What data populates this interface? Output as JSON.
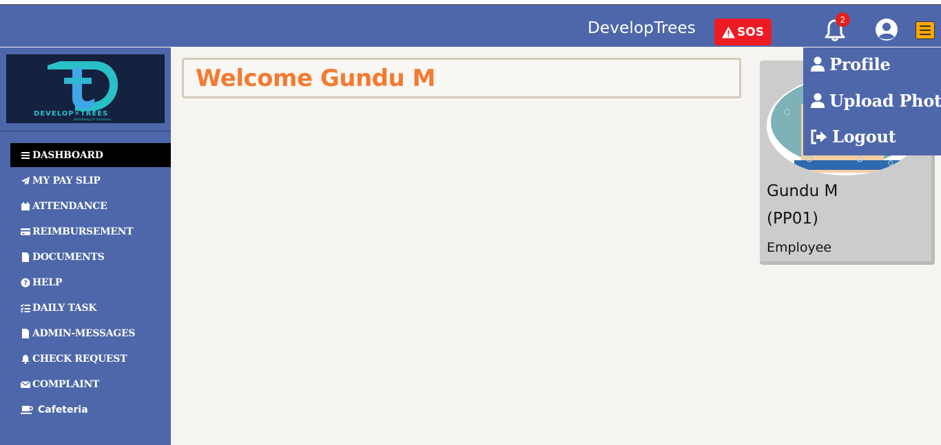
{
  "header": {
    "brand": "DevelopTrees",
    "sos_label": "SOS",
    "notification_count": "2",
    "colors": {
      "bar": "#4d67aa",
      "sos": "#ee1b24",
      "menu": "#ffa800"
    },
    "icons": [
      "warning-icon",
      "bell-icon",
      "user-circle-icon",
      "hamburger-icon"
    ]
  },
  "sidebar": {
    "logo": {
      "text": "DEVELOPTREES",
      "tagline": "Redefining IT Solutions"
    },
    "items": [
      {
        "label": "DASHBOARD",
        "icon": "bars-icon",
        "active": true
      },
      {
        "label": "MY PAY SLIP",
        "icon": "paper-plane-icon"
      },
      {
        "label": "ATTENDANCE",
        "icon": "calendar-icon"
      },
      {
        "label": "REIMBURSEMENT",
        "icon": "credit-card-icon"
      },
      {
        "label": "DOCUMENTS",
        "icon": "file-icon"
      },
      {
        "label": "HELP",
        "icon": "question-circle-icon"
      },
      {
        "label": "DAILY TASK",
        "icon": "list-check-icon"
      },
      {
        "label": "ADMIN-MESSAGES",
        "icon": "file-icon"
      },
      {
        "label": "CHECK REQUEST",
        "icon": "bell-icon"
      },
      {
        "label": "COMPLAINT",
        "icon": "envelope-icon"
      },
      {
        "label": "Cafeteria",
        "icon": "coffee-icon"
      }
    ]
  },
  "main": {
    "welcome": "Welcome Gundu M"
  },
  "profile_card": {
    "name": "Gundu M",
    "employee_id": "(PP01)",
    "role": "Employee"
  },
  "dropdown": {
    "items": [
      {
        "label": "Profile",
        "icon": "user-icon"
      },
      {
        "label": "Upload Photo",
        "icon": "user-icon"
      },
      {
        "label": "Logout",
        "icon": "sign-out-icon"
      }
    ]
  }
}
